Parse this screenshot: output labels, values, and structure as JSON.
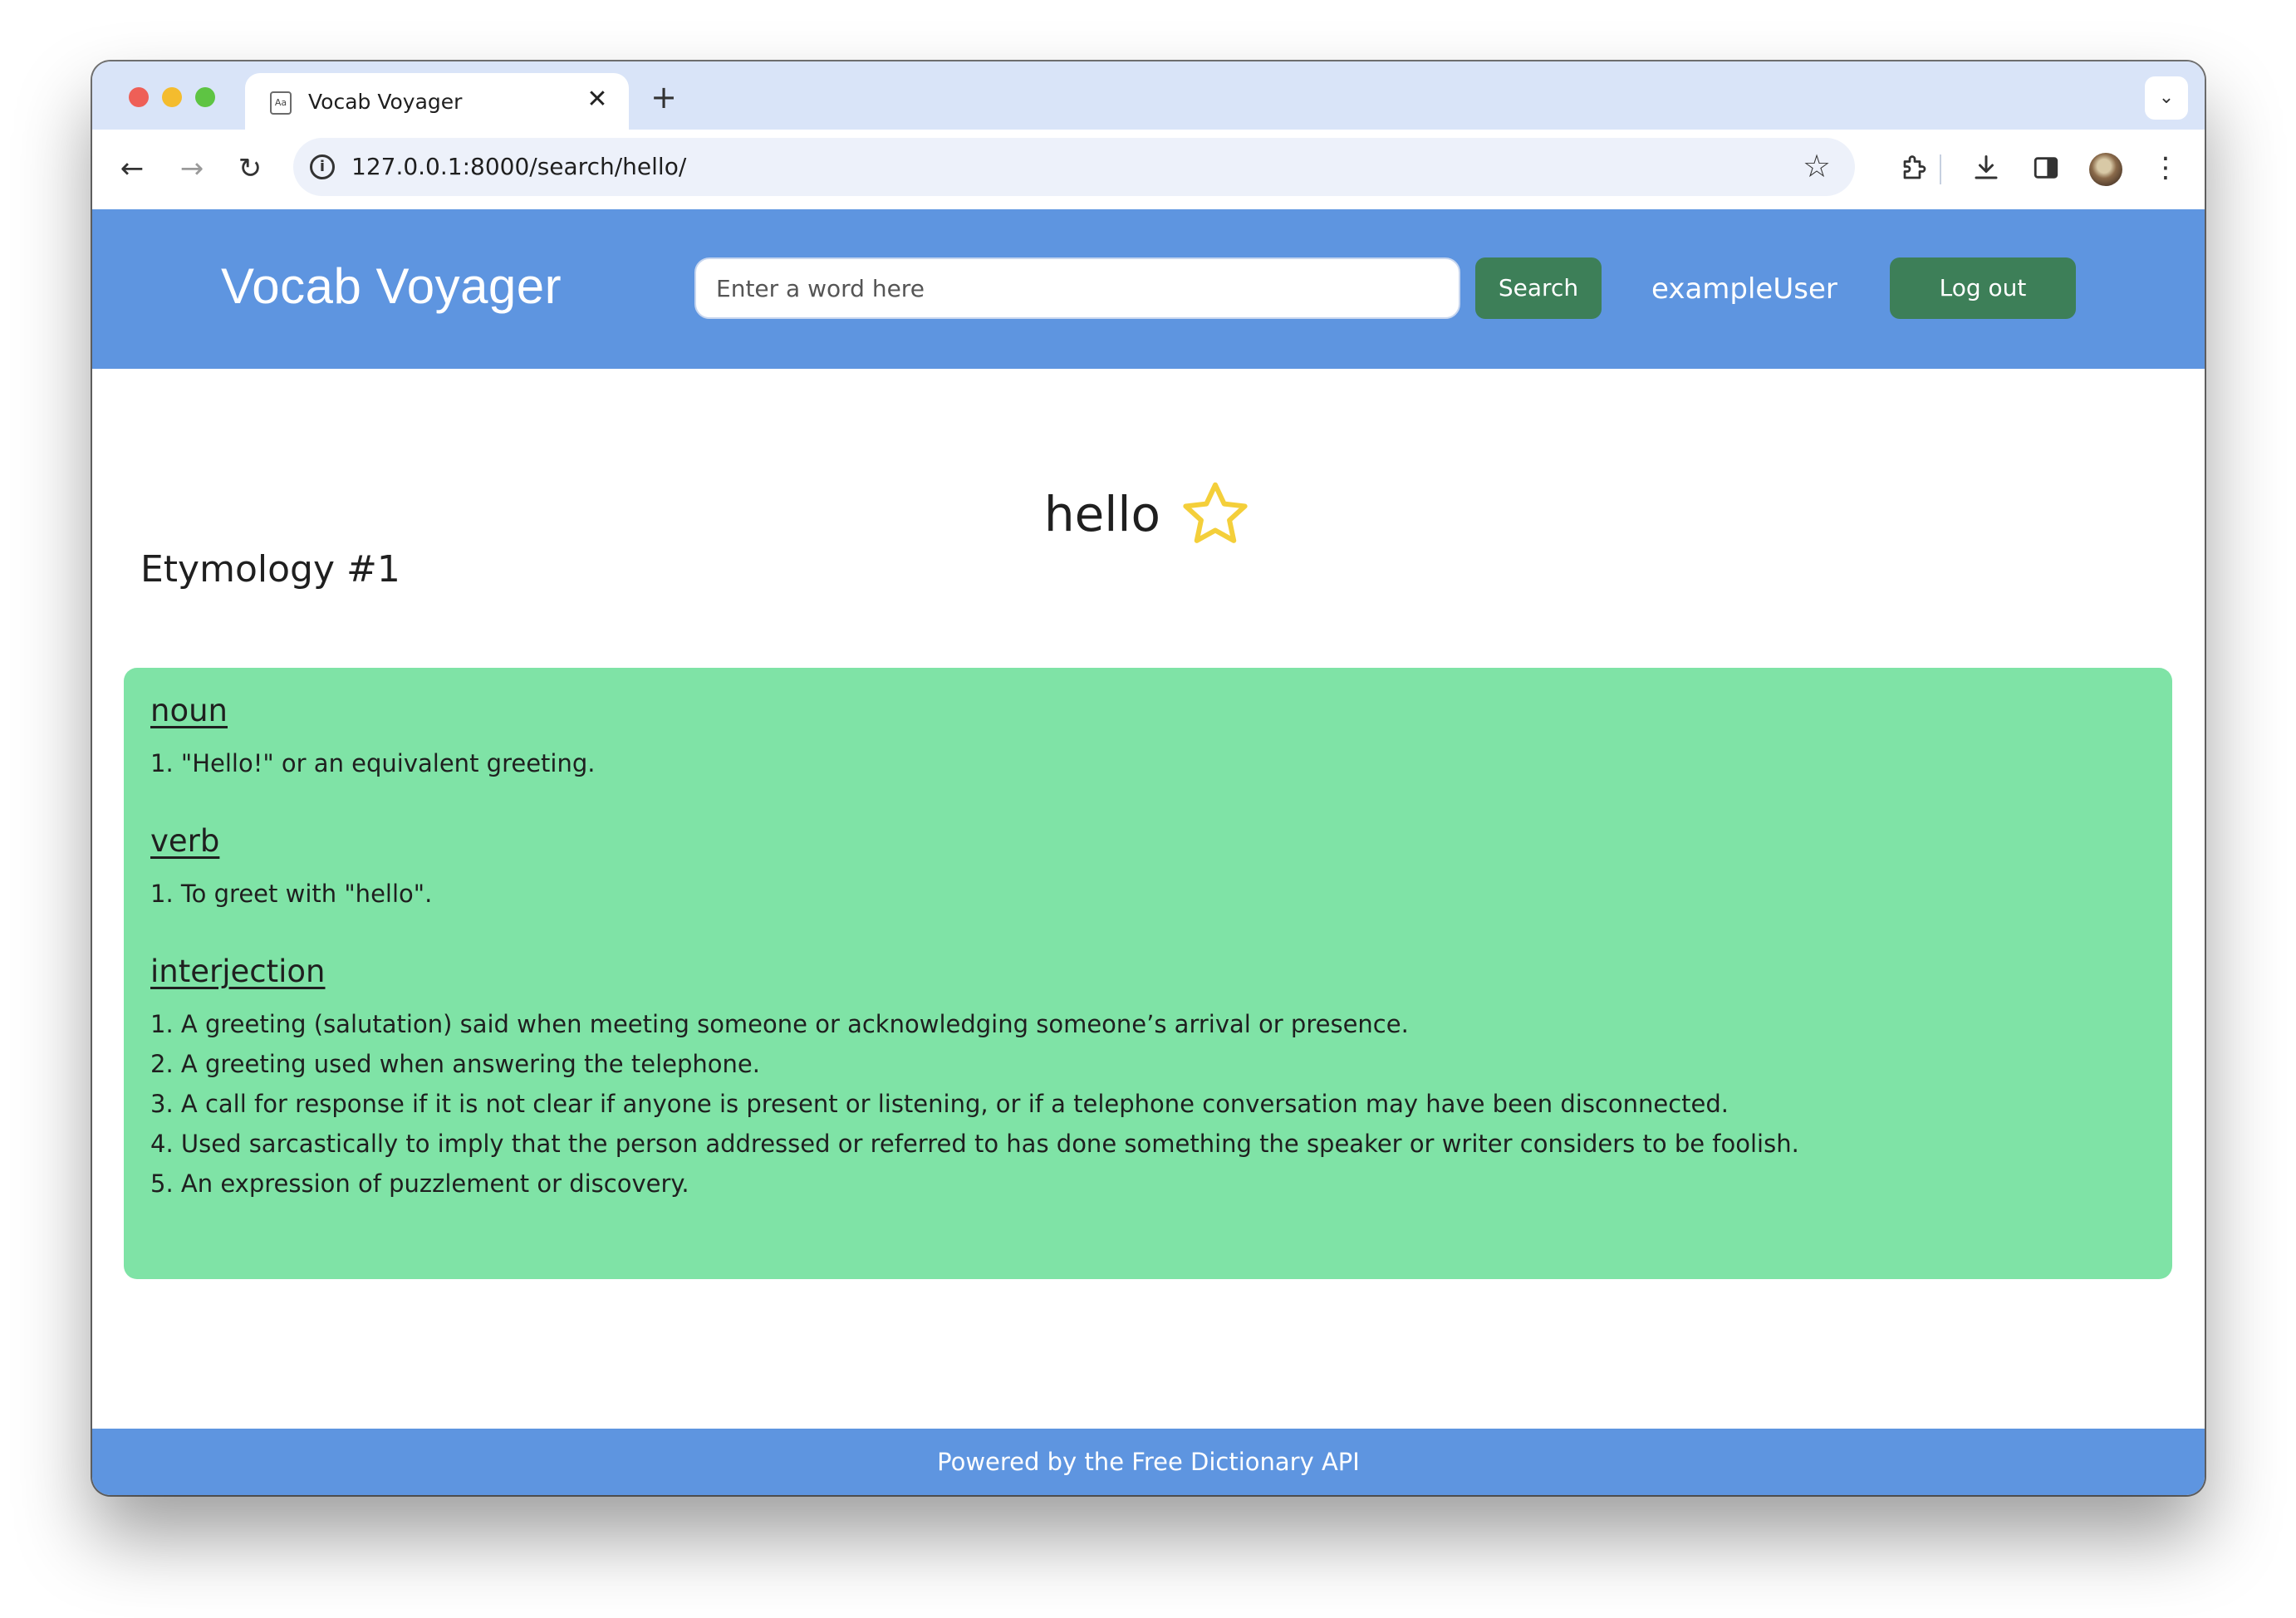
{
  "browser": {
    "tab_title": "Vocab Voyager",
    "favicon_text": "Aa",
    "url": "127.0.0.1:8000/search/hello/"
  },
  "header": {
    "brand": "Vocab Voyager",
    "search_placeholder": "Enter a word here",
    "search_button": "Search",
    "username": "exampleUser",
    "logout_button": "Log out"
  },
  "entry": {
    "word": "hello",
    "favorited": false,
    "etymology_title": "Etymology #1",
    "parts_of_speech": [
      {
        "label": "noun",
        "definitions": [
          "1. \"Hello!\" or an equivalent greeting."
        ]
      },
      {
        "label": "verb",
        "definitions": [
          "1. To greet with \"hello\"."
        ]
      },
      {
        "label": "interjection",
        "definitions": [
          "1. A greeting (salutation) said when meeting someone or acknowledging someone’s arrival or presence.",
          "2. A greeting used when answering the telephone.",
          "3. A call for response if it is not clear if anyone is present or listening, or if a telephone conversation may have been disconnected.",
          "4. Used sarcastically to imply that the person addressed or referred to has done something the speaker or writer considers to be foolish.",
          "5. An expression of puzzlement or discovery."
        ]
      }
    ]
  },
  "footer": {
    "text": "Powered by the Free Dictionary API"
  },
  "colors": {
    "header_bg": "#5e95e0",
    "button_bg": "#3d7f58",
    "card_bg": "#7fe3a6",
    "star": "#f4cf3a"
  }
}
